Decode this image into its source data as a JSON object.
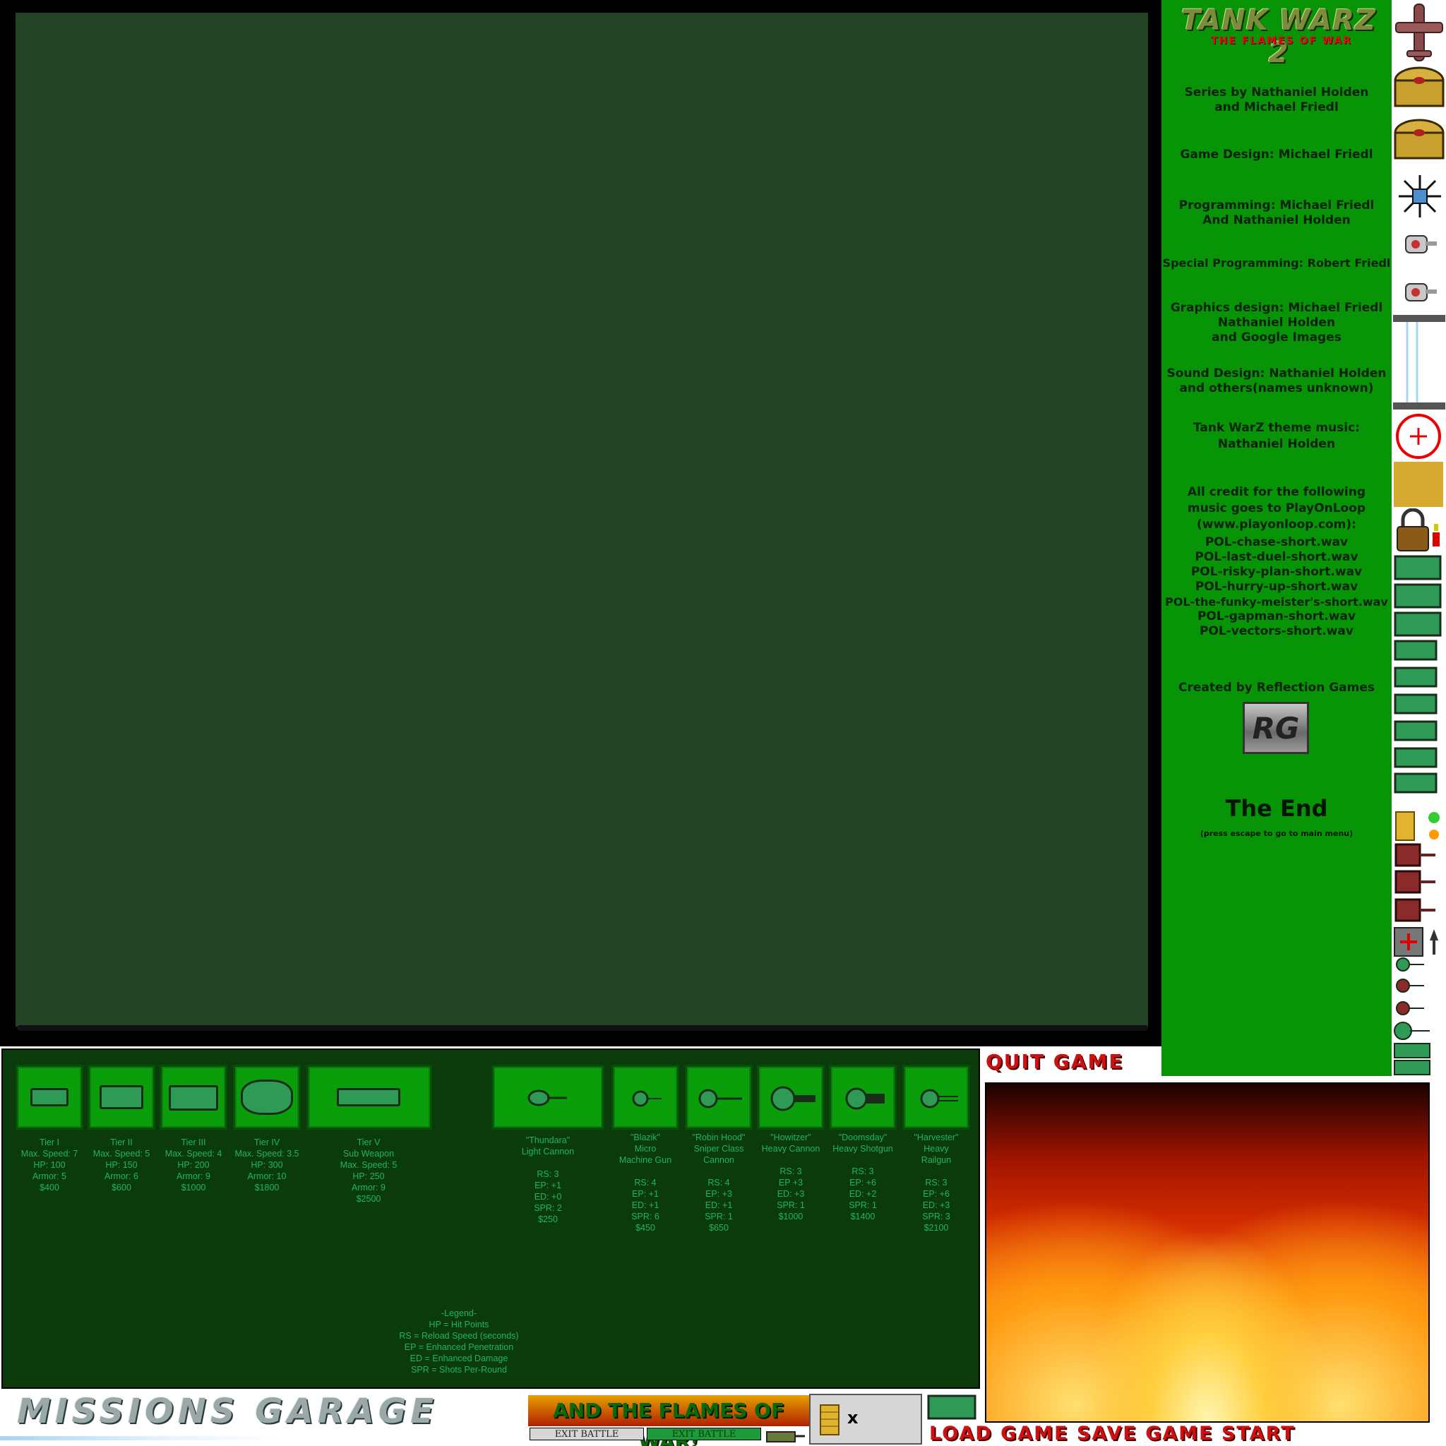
{
  "credits": {
    "logo_title": "TANK WARZ 2",
    "logo_subtitle": "THE FLAMES OF WAR",
    "series": "Series by Nathaniel Holden\nand Michael Friedl",
    "game_design": "Game Design: Michael Friedl",
    "programming": "Programming: Michael Friedl\nAnd Nathaniel Holden",
    "special_programming": "Special Programming: Robert Friedl",
    "graphics": "Graphics design: Michael Friedl\nNathaniel Holden\nand Google Images",
    "sound": "Sound Design: Nathaniel Holden\nand others(names unknown)",
    "theme_music": "Tank WarZ theme music:\nNathaniel Holden",
    "music_credit": "All credit for the following\nmusic goes to PlayOnLoop\n(www.playonloop.com):",
    "tracks": [
      "POL-chase-short.wav",
      "POL-last-duel-short.wav",
      "POL-risky-plan-short.wav",
      "POL-hurry-up-short.wav",
      "POL-the-funky-meister's-short.wav",
      "POL-gapman-short.wav",
      "POL-vectors-short.wav"
    ],
    "created_by": "Created by Reflection Games",
    "rg_logo": "RG",
    "the_end": "The End",
    "escape_hint": "(press escape to go to main menu)"
  },
  "shop": {
    "tanks": [
      {
        "text": "Tier I\nMax. Speed: 7\nHP: 100\nArmor: 5\n$400"
      },
      {
        "text": "Tier II\nMax. Speed: 5\nHP: 150\nArmor: 6\n$600"
      },
      {
        "text": "Tier III\nMax. Speed: 4\nHP: 200\nArmor: 9\n$1000"
      },
      {
        "text": "Tier IV\nMax. Speed: 3.5\nHP: 300\nArmor: 10\n$1800"
      },
      {
        "text": "Tier V\nSub Weapon\nMax. Speed: 5\nHP: 250\nArmor: 9\n$2500"
      }
    ],
    "weapons": [
      {
        "text": "\"Thundara\"\nLight Cannon\n\nRS: 3\nEP: +1\nED: +0\nSPR: 2\n$250"
      },
      {
        "text": "\"Blazik\"\nMicro\nMachine Gun\n\nRS: 4\nEP: +1\nED: +1\nSPR: 6\n$450"
      },
      {
        "text": "\"Robin Hood\"\nSniper Class\nCannon\n\nRS: 4\nEP: +3\nED: +1\nSPR: 1\n$650"
      },
      {
        "text": "\"Howitzer\"\nHeavy Cannon\n\nRS: 3\nEP +3\nED: +3\nSPR: 1\n$1000"
      },
      {
        "text": "\"Doomsday\"\nHeavy Shotgun\n\nRS: 3\nEP: +6\nED: +2\nSPR: 1\n$1400"
      },
      {
        "text": "\"Harvester\"\nHeavy\nRailgun\n\nRS: 3\nEP: +6\nED: +3\nSPR: 3\n$2100"
      }
    ],
    "legend": "-Legend-\nHP = Hit Points\nRS = Reload Speed (seconds)\nEP = Enhanced Penetration\nED = Enhanced Damage\nSPR = Shots Per-Round"
  },
  "bottom": {
    "missions_garage": "MISSIONS GARAGE",
    "flames_title": "AND THE FLAMES OF WAR!",
    "exit_battle_1": "EXIT BATTLE",
    "exit_battle_2": "EXIT BATTLE",
    "coin_x": "x",
    "quit_game": "QUIT GAME",
    "load_save_start": "LOAD GAME SAVE GAME START"
  },
  "colors": {
    "playfield": "#224425",
    "credits_panel": "#079507",
    "shop_panel": "#0b3a0b",
    "card": "#0a9e0a",
    "info_text": "#21b55a",
    "menu_red": "#d01010"
  },
  "icons": [
    "bomber-plane-icon",
    "gold-barrel-icon",
    "spiked-mine-icon",
    "turret-pod-icon",
    "crosshair-icon",
    "lock-icon",
    "tank-sprite-icon",
    "coin-stack-icon",
    "red-tank-icon",
    "health-plus-icon",
    "missile-icon"
  ]
}
